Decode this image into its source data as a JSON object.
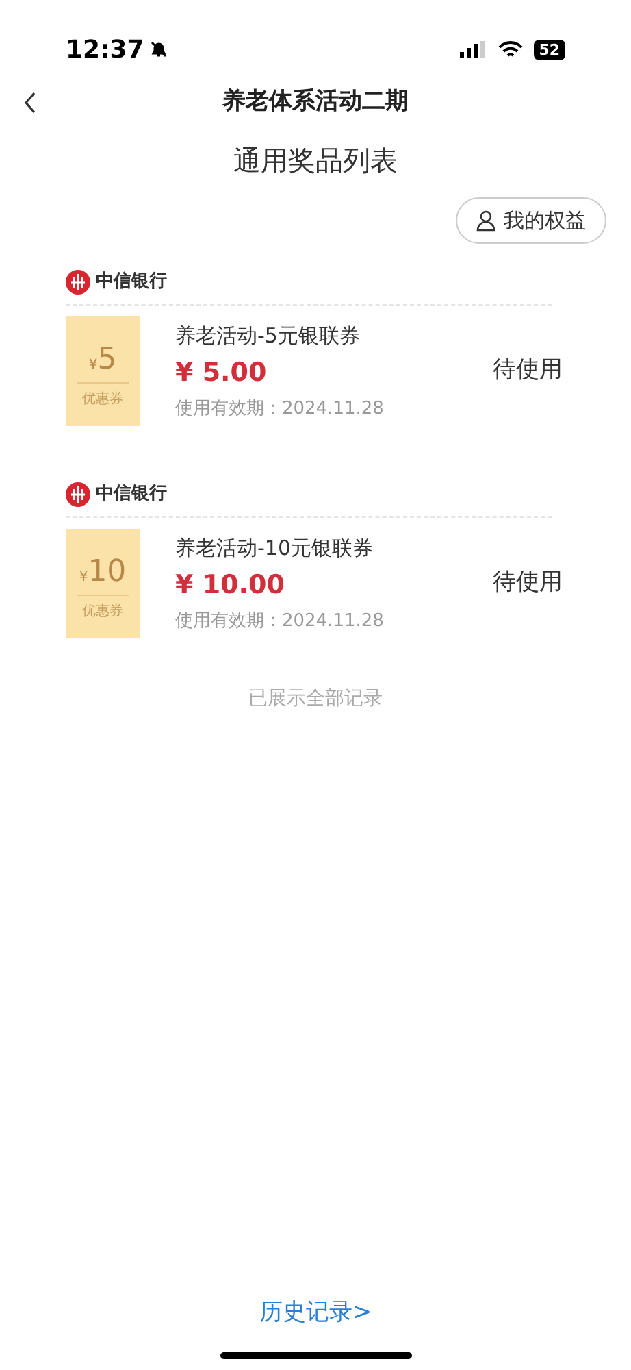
{
  "status_bar": {
    "time": "12:37",
    "battery": "52"
  },
  "nav": {
    "title": "养老体系活动二期"
  },
  "subtitle": "通用奖品列表",
  "benefits_button": "我的权益",
  "coupons": [
    {
      "bank": "中信银行",
      "stub_currency": "¥",
      "stub_amount": "5",
      "stub_label": "优惠券",
      "name": "养老活动-5元银联券",
      "price": "¥ 5.00",
      "validity": "使用有效期：2024.11.28",
      "status": "待使用"
    },
    {
      "bank": "中信银行",
      "stub_currency": "¥",
      "stub_amount": "10",
      "stub_label": "优惠券",
      "name": "养老活动-10元银联券",
      "price": "¥ 10.00",
      "validity": "使用有效期：2024.11.28",
      "status": "待使用"
    }
  ],
  "end_note": "已展示全部记录",
  "history_link": "历史记录>"
}
